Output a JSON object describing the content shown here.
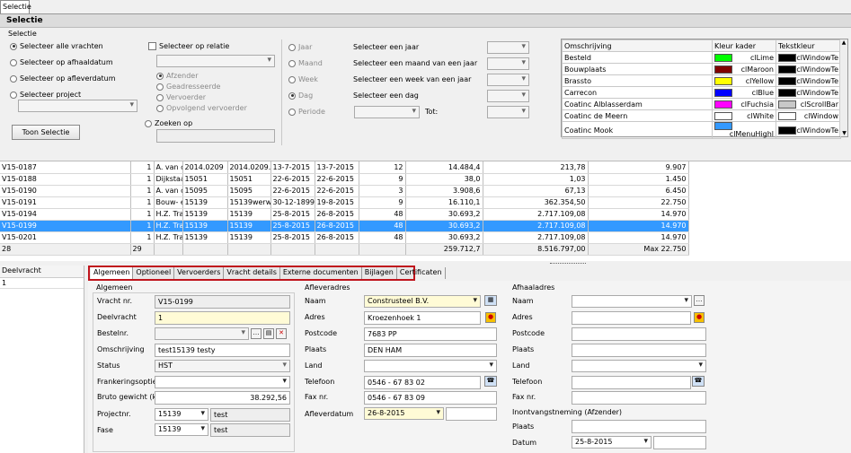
{
  "top_tab": "Selectie",
  "section_title": "Selectie",
  "selectie_group": "Selectie",
  "radios": [
    {
      "label": "Selecteer alle vrachten",
      "on": true
    },
    {
      "label": "Selecteer op afhaaldatum",
      "on": false
    },
    {
      "label": "Selecteer op afleverdatum",
      "on": false
    },
    {
      "label": "Selecteer project",
      "on": false
    }
  ],
  "toon_selectie": "Toon Selectie",
  "relatie": {
    "check_label": "Selecteer op relatie",
    "options": [
      {
        "label": "Afzender",
        "on": true
      },
      {
        "label": "Geadresseerde",
        "on": false
      },
      {
        "label": "Vervoerder",
        "on": false
      },
      {
        "label": "Opvolgend vervoerder",
        "on": false
      }
    ],
    "zoeken_label": "Zoeken op"
  },
  "period": [
    {
      "radio": "Jaar",
      "text": "Selecteer een jaar",
      "on": false
    },
    {
      "radio": "Maand",
      "text": "Selecteer een maand van een jaar",
      "on": false
    },
    {
      "radio": "Week",
      "text": "Selecteer een week van een jaar",
      "on": false
    },
    {
      "radio": "Dag",
      "text": "Selecteer een dag",
      "on": true
    },
    {
      "radio": "Periode",
      "text": "",
      "on": false
    }
  ],
  "tot_label": "Tot:",
  "legend": {
    "headers": [
      "Omschrijving",
      "Kleur kader",
      "Tekstkleur"
    ],
    "rows": [
      {
        "name": "Besteld",
        "kader": "clLime",
        "kader_color": "#00ff00",
        "tekst": "clWindowTe",
        "tekst_color": "#000000"
      },
      {
        "name": "Bouwplaats",
        "kader": "clMaroon",
        "kader_color": "#800000",
        "tekst": "clWindowTe",
        "tekst_color": "#000000"
      },
      {
        "name": "Brassto",
        "kader": "clYellow",
        "kader_color": "#ffff00",
        "tekst": "clWindowTe",
        "tekst_color": "#000000"
      },
      {
        "name": "Carrecon",
        "kader": "clBlue",
        "kader_color": "#0000ff",
        "tekst": "clWindowTe",
        "tekst_color": "#000000"
      },
      {
        "name": "Coatinc Alblasserdam",
        "kader": "clFuchsia",
        "kader_color": "#ff00ff",
        "tekst": "clScrollBar",
        "tekst_color": "#c8c8c8"
      },
      {
        "name": "Coatinc de Meern",
        "kader": "clWhite",
        "kader_color": "#ffffff",
        "tekst": "clWindow",
        "tekst_color": "#ffffff"
      },
      {
        "name": "Coatinc Mook",
        "kader": "clMenuHighl",
        "kader_color": "#3399ff",
        "tekst": "clWindowTe",
        "tekst_color": "#000000"
      }
    ]
  },
  "grid": {
    "rows": [
      [
        "V15-0187",
        "1",
        "A. van c",
        "2014.0209",
        "2014.0209.",
        "13-7-2015",
        "13-7-2015",
        "12",
        "14.484,4",
        "213,78",
        "9.907"
      ],
      [
        "V15-0188",
        "1",
        "Dijkstaa",
        "15051",
        "15051",
        "22-6-2015",
        "22-6-2015",
        "9",
        "38,0",
        "1,03",
        "1.450"
      ],
      [
        "V15-0190",
        "1",
        "A. van c",
        "15095",
        "15095",
        "22-6-2015",
        "22-6-2015",
        "3",
        "3.908,6",
        "67,13",
        "6.450"
      ],
      [
        "V15-0191",
        "1",
        "Bouw- e",
        "15139",
        "15139werw",
        "30-12-1899",
        "19-8-2015",
        "9",
        "16.110,1",
        "362.354,50",
        "22.750"
      ],
      [
        "V15-0194",
        "1",
        "H.Z. Tra",
        "15139",
        "15139",
        "25-8-2015",
        "26-8-2015",
        "48",
        "30.693,2",
        "2.717.109,08",
        "14.970"
      ],
      [
        "V15-0199",
        "1",
        "H.Z. Tra",
        "15139",
        "15139",
        "25-8-2015",
        "26-8-2015",
        "48",
        "30.693,2",
        "2.717.109,08",
        "14.970"
      ],
      [
        "V15-0201",
        "1",
        "H.Z. Tra",
        "15139",
        "15139",
        "25-8-2015",
        "26-8-2015",
        "48",
        "30.693,2",
        "2.717.109,08",
        "14.970"
      ]
    ],
    "selected_index": 5,
    "footer": [
      "28",
      "29",
      "",
      "",
      "",
      "",
      "",
      "",
      "259.712,7",
      "8.516.797,00",
      "Max 22.750"
    ]
  },
  "deelvracht": {
    "header": "Deelvracht",
    "value": "1"
  },
  "tabs": [
    "Algemeen",
    "Optioneel",
    "Vervoerders",
    "Vracht details",
    "Externe documenten",
    "Bijlagen",
    "Certificaten"
  ],
  "algemeen": {
    "title": "Algemeen",
    "vrachtnr_label": "Vracht nr.",
    "vrachtnr": "V15-0199",
    "deelvracht_label": "Deelvracht",
    "deelvracht": "1",
    "bestelnr_label": "Bestelnr.",
    "bestelnr": "",
    "omschrijving_label": "Omschrijving",
    "omschrijving": "test15139 testy",
    "status_label": "Status",
    "status": "HST",
    "frank_label": "Frankeringsopties",
    "frank": "",
    "bruto_label": "Bruto gewicht (kg)",
    "bruto": "38.292,56",
    "project_label": "Projectnr.",
    "project": "15139",
    "project_desc": "test",
    "fase_label": "Fase",
    "fase": "15139",
    "fase_desc": "test"
  },
  "aflever": {
    "title": "Afleveradres",
    "naam_label": "Naam",
    "naam": "Construsteel  B.V.",
    "adres_label": "Adres",
    "adres": "Kroezenhoek 1",
    "postcode_label": "Postcode",
    "postcode": "7683 PP",
    "plaats_label": "Plaats",
    "plaats": "DEN HAM",
    "land_label": "Land",
    "land": "",
    "telefoon_label": "Telefoon",
    "telefoon": "0546 - 67 83 02",
    "fax_label": "Fax nr.",
    "fax": "0546 - 67 83 09",
    "datum_label": "Afleverdatum",
    "datum": "26-8-2015"
  },
  "afhaal": {
    "title": "Afhaaladres",
    "naam_label": "Naam",
    "naam": "",
    "adres_label": "Adres",
    "adres": "",
    "postcode_label": "Postcode",
    "postcode": "",
    "plaats_label": "Plaats",
    "plaats": "",
    "land_label": "Land",
    "land": "",
    "telefoon_label": "Telefoon",
    "telefoon": "",
    "fax_label": "Fax nr.",
    "fax": ""
  },
  "inontvangst": {
    "title": "Inontvangstneming (Afzender)",
    "plaats_label": "Plaats",
    "plaats": "",
    "datum_label": "Datum",
    "datum": "25-8-2015"
  },
  "colors": {
    "selection": "#3399ff",
    "highlight_border": "#c0141c",
    "yellow_field": "#fffbd6"
  }
}
